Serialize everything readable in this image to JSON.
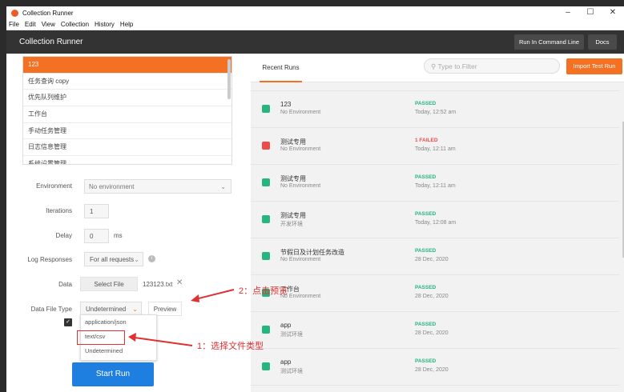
{
  "window": {
    "title": "Collection Runner",
    "controls": [
      "–",
      "☐",
      "✕"
    ]
  },
  "menu": [
    "File",
    "Edit",
    "View",
    "Collection",
    "History",
    "Help"
  ],
  "header": {
    "title": "Collection Runner",
    "cmd_button": "Run In Command Line",
    "docs_button": "Docs"
  },
  "collections": [
    "123",
    "任务查询 copy",
    "优先队列维护",
    "工作台",
    "手动任务管理",
    "日志信息管理",
    "系统设置管理"
  ],
  "form": {
    "environment_label": "Environment",
    "environment_value": "No environment",
    "iterations_label": "Iterations",
    "iterations_value": "1",
    "delay_label": "Delay",
    "delay_value": "0",
    "delay_unit": "ms",
    "log_label": "Log Responses",
    "log_value": "For all requests",
    "data_label": "Data",
    "select_file": "Select File",
    "file_name": "123123.txt",
    "filetype_label": "Data File Type",
    "filetype_value": "Undetermined",
    "preview": "Preview",
    "filetype_options": [
      "application/json",
      "text/csv",
      "Undetermined"
    ],
    "start_run": "Start Run"
  },
  "right": {
    "tab": "Recent Runs",
    "filter_placeholder": "Type to Filter",
    "import_button": "Import Test Run",
    "runs": [
      {
        "name": "123",
        "env": "No Environment",
        "status": "PASSED",
        "time": "Today, 12:52 am",
        "color": "#26b47f"
      },
      {
        "name": "测试专用",
        "env": "No Environment",
        "status": "1 FAILED",
        "time": "Today, 12:11 am",
        "color": "#ed4b48"
      },
      {
        "name": "测试专用",
        "env": "No Environment",
        "status": "PASSED",
        "time": "Today, 12:11 am",
        "color": "#26b47f"
      },
      {
        "name": "测试专用",
        "env": "开发环境",
        "status": "PASSED",
        "time": "Today, 12:08 am",
        "color": "#26b47f"
      },
      {
        "name": "节假日及计划任务改造",
        "env": "No Environment",
        "status": "PASSED",
        "time": "28 Dec, 2020",
        "color": "#26b47f"
      },
      {
        "name": "工作台",
        "env": "No Environment",
        "status": "PASSED",
        "time": "28 Dec, 2020",
        "color": "#26b47f"
      },
      {
        "name": "app",
        "env": "测试环境",
        "status": "PASSED",
        "time": "28 Dec, 2020",
        "color": "#26b47f"
      },
      {
        "name": "app",
        "env": "测试环境",
        "status": "PASSED",
        "time": "28 Dec, 2020",
        "color": "#26b47f"
      }
    ]
  },
  "annotations": {
    "step1": "1：选择文件类型",
    "step2": "2：点击预览"
  },
  "colors": {
    "accent": "#f47023",
    "primary": "#1f7fe0",
    "passed": "#26b47f",
    "failed": "#ed4b48",
    "annotation": "#e03030"
  }
}
